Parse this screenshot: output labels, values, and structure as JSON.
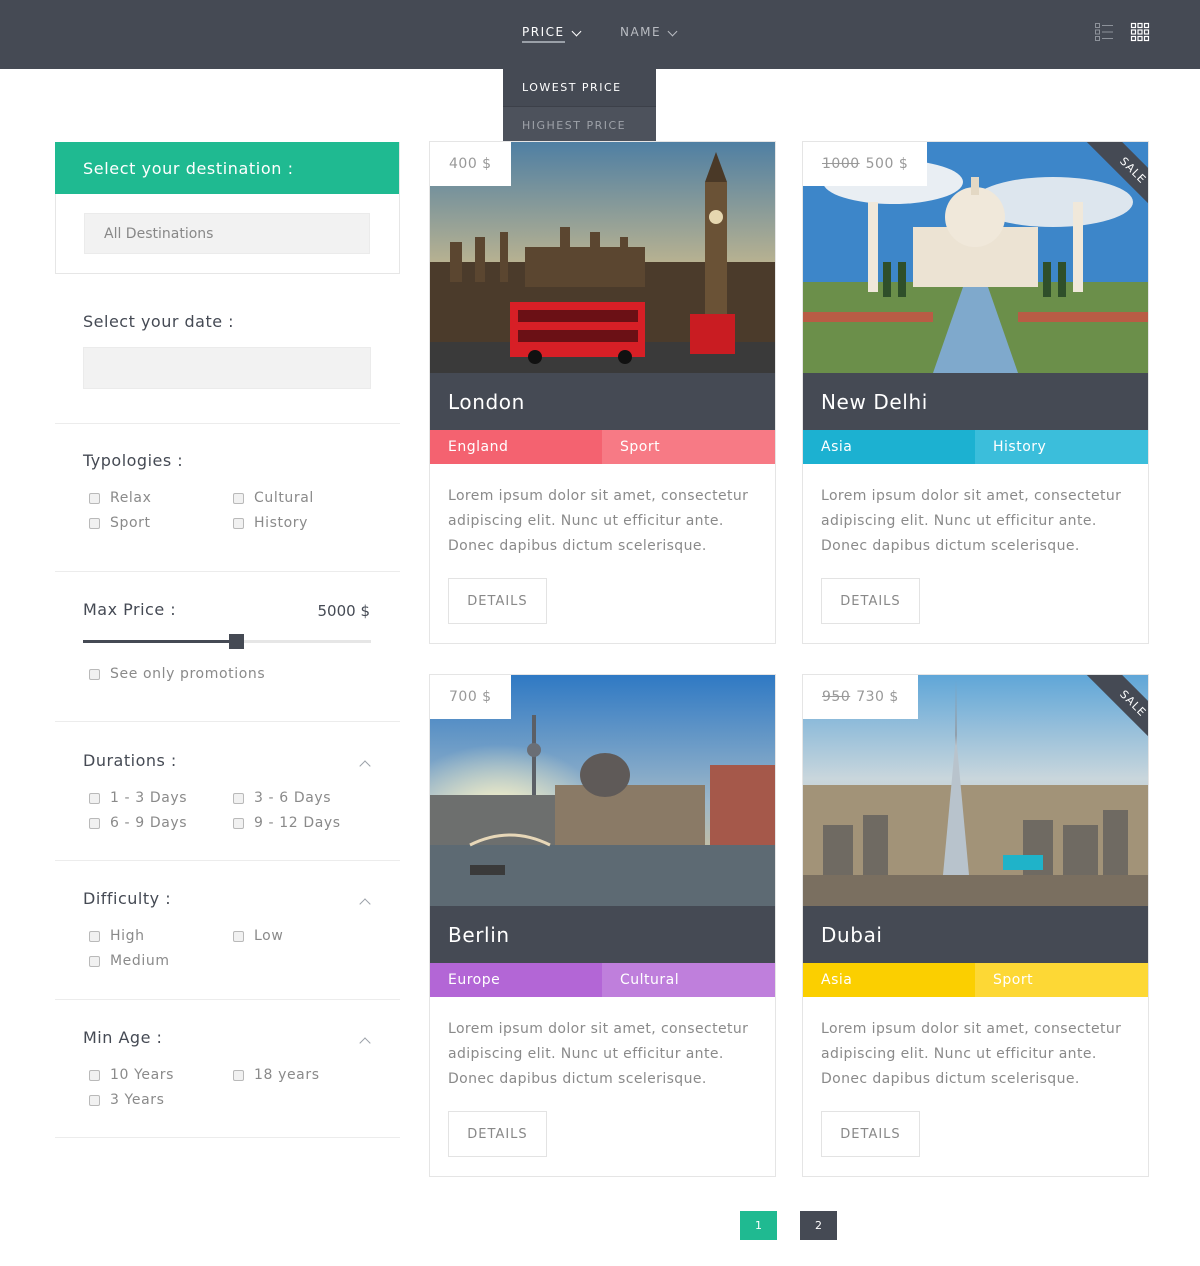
{
  "colors": {
    "header_bg": "#454a54",
    "accent_green": "#1fba91",
    "tag_red": "#f46270",
    "tag_cyan": "#1cb1d1",
    "tag_purple": "#b366d6",
    "tag_yellow": "#fbcf00"
  },
  "sort_bar": {
    "price_label": "PRICE",
    "name_label": "NAME",
    "dropdown": {
      "lowest": "LOWEST PRICE",
      "highest": "HIGHEST PRICE"
    },
    "view_icons": [
      "list-view-icon",
      "grid-view-icon"
    ]
  },
  "sidebar": {
    "destination": {
      "title": "Select your destination :",
      "selected": "All Destinations"
    },
    "date": {
      "title": "Select your date :",
      "value": ""
    },
    "typologies": {
      "title": "Typologies :",
      "options": [
        "Relax",
        "Cultural",
        "Sport",
        "History"
      ]
    },
    "max_price": {
      "title": "Max Price :",
      "value_label": "5000 $",
      "slider_fraction": 0.53,
      "promo_label": "See only promotions"
    },
    "durations": {
      "title": "Durations :",
      "options": [
        "1 - 3 Days",
        "3 - 6 Days",
        "6 - 9 Days",
        "9 - 12 Days"
      ]
    },
    "difficulty": {
      "title": "Difficulty :",
      "options": [
        "High",
        "Low",
        "Medium"
      ]
    },
    "min_age": {
      "title": "Min Age :",
      "options": [
        "10 Years",
        "18 years",
        "3 Years"
      ]
    }
  },
  "cards": [
    {
      "price": "400 $",
      "old_price": "",
      "sale": "",
      "city": "London",
      "tags": [
        "England",
        "Sport"
      ],
      "text": "Lorem ipsum dolor sit amet, consectetur adipiscing elit. Nunc ut efficitur ante. Donec dapibus dictum scelerisque.",
      "button": "DETAILS"
    },
    {
      "price": "500 $",
      "old_price": "1000",
      "sale": "SALE",
      "city": "New Delhi",
      "tags": [
        "Asia",
        "History"
      ],
      "text": "Lorem ipsum dolor sit amet, consectetur adipiscing elit. Nunc ut efficitur ante. Donec dapibus dictum scelerisque.",
      "button": "DETAILS"
    },
    {
      "price": "700 $",
      "old_price": "",
      "sale": "",
      "city": "Berlin",
      "tags": [
        "Europe",
        "Cultural"
      ],
      "text": "Lorem ipsum dolor sit amet, consectetur adipiscing elit. Nunc ut efficitur ante. Donec dapibus dictum scelerisque.",
      "button": "DETAILS"
    },
    {
      "price": "730 $",
      "old_price": "950",
      "sale": "SALE",
      "city": "Dubai",
      "tags": [
        "Asia",
        "Sport"
      ],
      "text": "Lorem ipsum dolor sit amet, consectetur adipiscing elit. Nunc ut efficitur ante. Donec dapibus dictum scelerisque.",
      "button": "DETAILS"
    }
  ],
  "pagination": [
    "1",
    "2"
  ]
}
